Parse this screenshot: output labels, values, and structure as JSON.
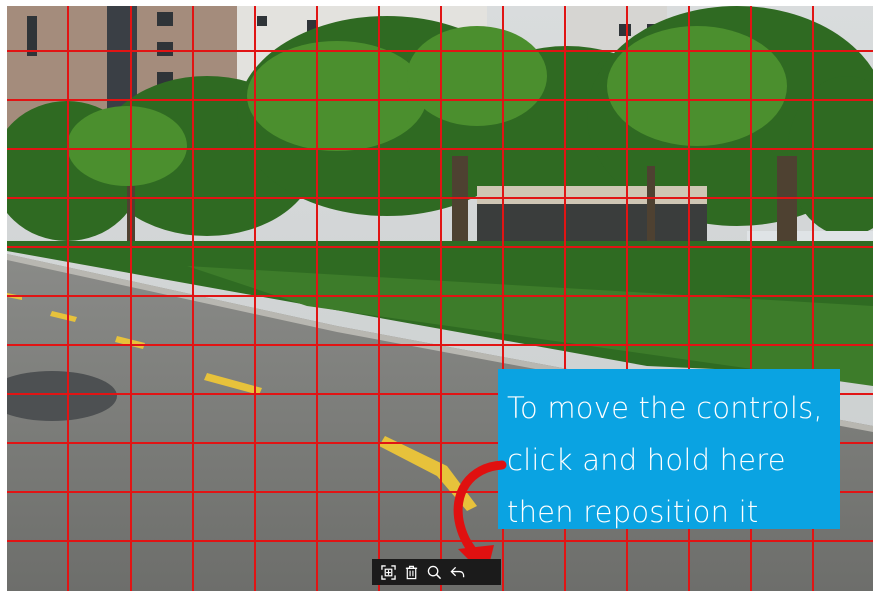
{
  "overlay": {
    "instruction_lines": [
      "To move the controls,",
      "click and hold here",
      "then reposition it"
    ],
    "callout_color": "#0aa3e2",
    "arrow_color": "#e01010",
    "grid_color": "#e11414"
  },
  "controls": {
    "buttons": [
      "fit-to-screen-icon",
      "delete-icon",
      "zoom-icon",
      "back-icon"
    ]
  }
}
